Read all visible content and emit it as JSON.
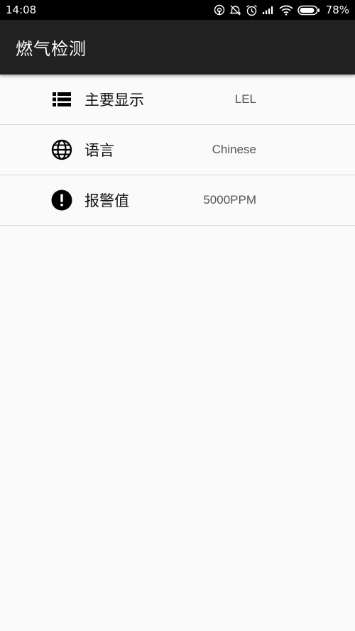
{
  "status_bar": {
    "time": "14:08",
    "battery": "78%"
  },
  "app_bar": {
    "title": "燃气检测"
  },
  "settings": [
    {
      "label": "主要显示",
      "value": "LEL",
      "icon": "list-icon"
    },
    {
      "label": "语言",
      "value": "Chinese",
      "icon": "globe-icon"
    },
    {
      "label": "报警值",
      "value": "5000PPM",
      "icon": "alert-icon"
    }
  ]
}
